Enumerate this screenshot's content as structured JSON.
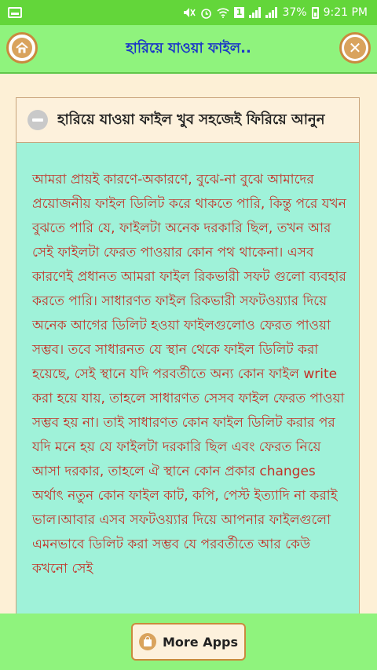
{
  "status_bar": {
    "sim_label": "1",
    "battery": "37%",
    "time": "9:21 PM"
  },
  "app_bar": {
    "title": "হারিয়ে যাওয়া ফাইল..",
    "home_icon": "home-icon",
    "close_icon": "close-icon"
  },
  "article": {
    "title": "হারিয়ে যাওয়া ফাইল খুব সহজেই ফিরিয়ে আনুন",
    "body": "আমরা প্রায়ই কারণে-অকারণে, বুঝে-না বুঝে আমাদের প্রয়োজনীয় ফাইল ডিলিট করে থাকতে পারি, কিন্তু পরে যখন বুঝতে পারি যে, ফাইলটা অনেক দরকারি ছিল, তখন আর সেই ফাইলটা ফেরত পাওয়ার কোন পথ থাকেনা। এসব কারণেই প্রধানত আমরা ফাইল রিকভারী সফট গুলো ব্যবহার করতে পারি। সাধারণত ফাইল রিকভারী সফটওয়্যার দিয়ে অনেক আগের ডিলিট হওয়া ফাইলগুলোও ফেরত পাওয়া সম্ভব। তবে সাধারনত যে স্থান থেকে ফাইল ডিলিট করা হয়েছে, সেই স্থানে যদি পরবর্তীতে অন্য কোন ফাইল write করা হয়ে যায়, তাহলে সাধারণত সেসব ফাইল ফেরত পাওয়া সম্ভব হয় না। তাই সাধারণত কোন ফাইল ডিলিট করার পর যদি মনে হয় যে ফাইলটা দরকারি ছিল এবং ফেরত নিয়ে আসা দরকার, তাহলে ঐ স্থানে কোন প্রকার changes অর্থাৎ নতুন কোন ফাইল কাট, কপি, পেস্ট ইত্যাদি না করাই ভাল।আবার এসব সফটওয়্যার দিয়ে আপনার ফাইলগুলো এমনভাবে ডিলিট করা সম্ভব যে পরবর্তীতে আর কেউ কখনো সেই"
  },
  "bottom_bar": {
    "more_apps_label": "More Apps",
    "more_apps_icon": "shopping-bag-icon"
  },
  "colors": {
    "status_bar": "#63d63a",
    "app_bar": "#8ff37d",
    "title_text": "#1a35c8",
    "body_text": "#c23228",
    "card_bg": "#9ff2d9",
    "page_bg": "#fdf0d6"
  }
}
